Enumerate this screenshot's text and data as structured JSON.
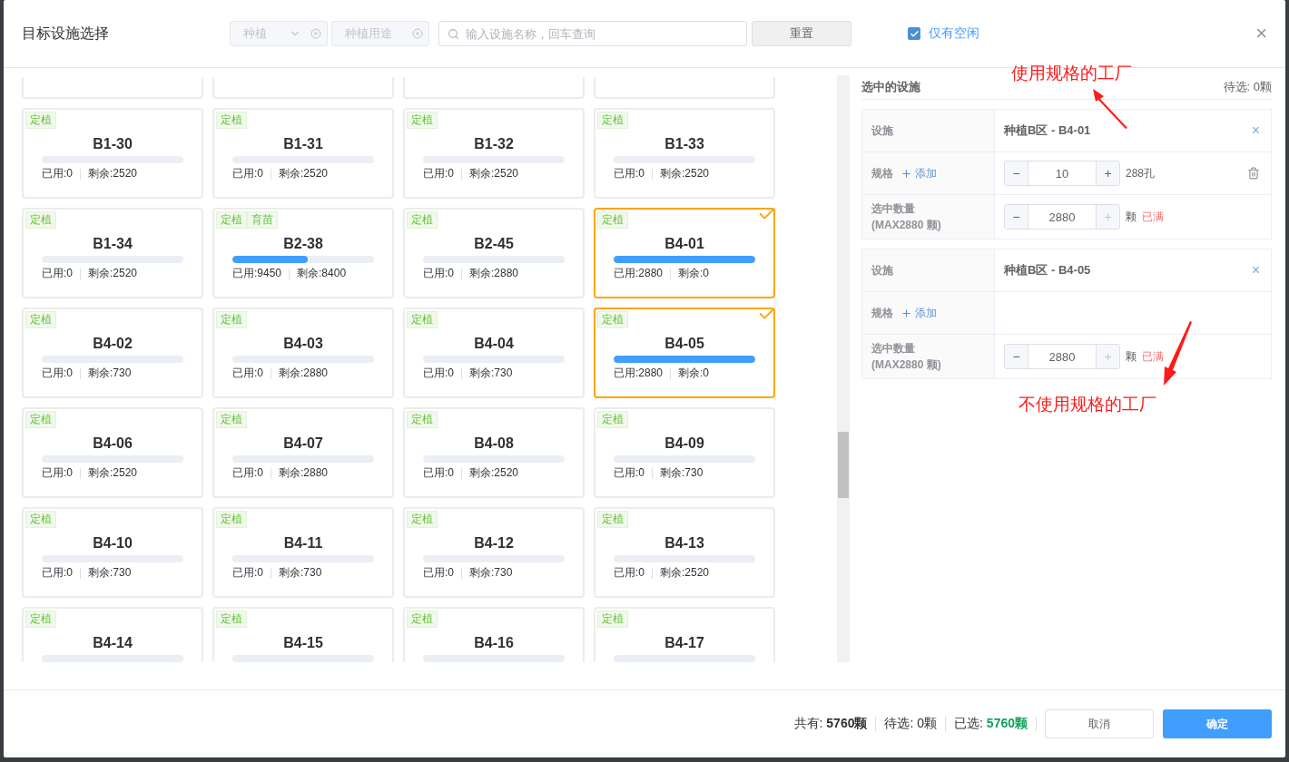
{
  "dialog": {
    "title": "目标设施选择",
    "close": "×"
  },
  "filters": {
    "type_select": {
      "value": "种植",
      "disabled": true
    },
    "use_select": {
      "placeholder": "种植用途",
      "disabled": true
    },
    "search": {
      "placeholder": "输入设施名称，回车查询"
    },
    "reset": "重置",
    "idle_only": {
      "label": "仅有空闲",
      "checked": true
    }
  },
  "cards": [
    {
      "name": "B1-30",
      "tags": [
        "定植"
      ],
      "level": 0,
      "used": "已用:0",
      "remaining": "剩余:2520",
      "selected": false
    },
    {
      "name": "B1-31",
      "tags": [
        "定植"
      ],
      "level": 0,
      "used": "已用:0",
      "remaining": "剩余:2520",
      "selected": false
    },
    {
      "name": "B1-32",
      "tags": [
        "定植"
      ],
      "level": 0,
      "used": "已用:0",
      "remaining": "剩余:2520",
      "selected": false
    },
    {
      "name": "B1-33",
      "tags": [
        "定植"
      ],
      "level": 0,
      "used": "已用:0",
      "remaining": "剩余:2520",
      "selected": false
    },
    {
      "name": "B1-34",
      "tags": [
        "定植"
      ],
      "level": 0,
      "used": "已用:0",
      "remaining": "剩余:2520",
      "selected": false
    },
    {
      "name": "B2-38",
      "tags": [
        "定植",
        "育苗"
      ],
      "level": 0.53,
      "used": "已用:9450",
      "remaining": "剩余:8400",
      "selected": false
    },
    {
      "name": "B2-45",
      "tags": [
        "定植"
      ],
      "level": 0,
      "used": "已用:0",
      "remaining": "剩余:2880",
      "selected": false
    },
    {
      "name": "B4-01",
      "tags": [
        "定植"
      ],
      "level": 1,
      "used": "已用:2880",
      "remaining": "剩余:0",
      "selected": true
    },
    {
      "name": "B4-02",
      "tags": [
        "定植"
      ],
      "level": 0,
      "used": "已用:0",
      "remaining": "剩余:730",
      "selected": false
    },
    {
      "name": "B4-03",
      "tags": [
        "定植"
      ],
      "level": 0,
      "used": "已用:0",
      "remaining": "剩余:2880",
      "selected": false
    },
    {
      "name": "B4-04",
      "tags": [
        "定植"
      ],
      "level": 0,
      "used": "已用:0",
      "remaining": "剩余:730",
      "selected": false
    },
    {
      "name": "B4-05",
      "tags": [
        "定植"
      ],
      "level": 1,
      "used": "已用:2880",
      "remaining": "剩余:0",
      "selected": true
    },
    {
      "name": "B4-06",
      "tags": [
        "定植"
      ],
      "level": 0,
      "used": "已用:0",
      "remaining": "剩余:2520",
      "selected": false
    },
    {
      "name": "B4-07",
      "tags": [
        "定植"
      ],
      "level": 0,
      "used": "已用:0",
      "remaining": "剩余:2880",
      "selected": false
    },
    {
      "name": "B4-08",
      "tags": [
        "定植"
      ],
      "level": 0,
      "used": "已用:0",
      "remaining": "剩余:2520",
      "selected": false
    },
    {
      "name": "B4-09",
      "tags": [
        "定植"
      ],
      "level": 0,
      "used": "已用:0",
      "remaining": "剩余:730",
      "selected": false
    },
    {
      "name": "B4-10",
      "tags": [
        "定植"
      ],
      "level": 0,
      "used": "已用:0",
      "remaining": "剩余:730",
      "selected": false
    },
    {
      "name": "B4-11",
      "tags": [
        "定植"
      ],
      "level": 0,
      "used": "已用:0",
      "remaining": "剩余:730",
      "selected": false
    },
    {
      "name": "B4-12",
      "tags": [
        "定植"
      ],
      "level": 0,
      "used": "已用:0",
      "remaining": "剩余:730",
      "selected": false
    },
    {
      "name": "B4-13",
      "tags": [
        "定植"
      ],
      "level": 0,
      "used": "已用:0",
      "remaining": "剩余:2520",
      "selected": false
    },
    {
      "name": "B4-14",
      "tags": [
        "定植"
      ],
      "level": 0,
      "selected": false
    },
    {
      "name": "B4-15",
      "tags": [
        "定植"
      ],
      "level": 0,
      "selected": false
    },
    {
      "name": "B4-16",
      "tags": [
        "定植"
      ],
      "level": 0,
      "selected": false
    },
    {
      "name": "B4-17",
      "tags": [
        "定植"
      ],
      "level": 0,
      "selected": false
    }
  ],
  "selected_panel": {
    "title": "选中的设施",
    "pending": "待选: 0颗",
    "items": [
      {
        "facility_label": "设施",
        "facility": "种植B区 - B4-01",
        "remove": "×",
        "spec_label": "规格",
        "add": "添加",
        "spec": {
          "minus": "−",
          "value": "10",
          "plus": "+",
          "unit": "288孔"
        },
        "qty_label": "选中数量\n(MAX2880 颗)",
        "qty": {
          "minus": "−",
          "value": "2880",
          "plus": "+",
          "unit": "颗",
          "status": "已满"
        }
      },
      {
        "facility_label": "设施",
        "facility": "种植B区 - B4-05",
        "remove": "×",
        "spec_label": "规格",
        "add": "添加",
        "qty_label": "选中数量\n(MAX2880 颗)",
        "qty": {
          "minus": "−",
          "value": "2880",
          "plus": "+",
          "unit": "颗",
          "status": "已满"
        }
      }
    ]
  },
  "annotations": [
    {
      "text": "使用规格的工厂"
    },
    {
      "text": "不使用规格的工厂"
    }
  ],
  "footer": {
    "total_label": "共有:",
    "total": "5760颗",
    "pending": "待选: 0颗",
    "chosen_label": "已选:",
    "chosen": "5760颗",
    "cancel": "取消",
    "confirm": "确定"
  }
}
